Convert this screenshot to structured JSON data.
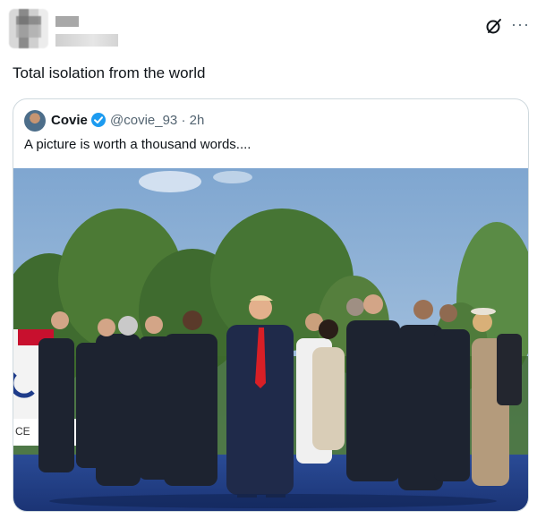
{
  "post": {
    "text": "Total isolation from the world",
    "more_label": "···",
    "icons": [
      "grok-icon",
      "more-icon"
    ]
  },
  "quote": {
    "author_name": "Covie",
    "author_handle": "@covie_93",
    "time": "2h",
    "handle_time": "@covie_93 · 2h",
    "text": "A picture is worth a thousand words....",
    "verified_color": "#1d9bf0",
    "photo_sign_text": "CE"
  },
  "colors": {
    "text": "#0f1419",
    "secondary": "#536471",
    "border": "#cfd9de",
    "stage": "#21418a",
    "sky": "#8fb3d8"
  }
}
